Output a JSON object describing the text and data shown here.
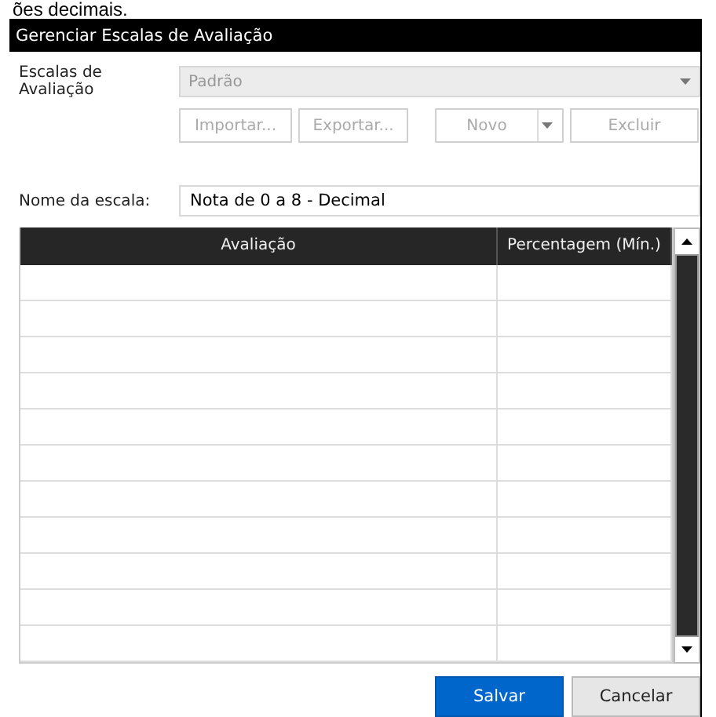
{
  "background_text": "ões decimais.",
  "window": {
    "title": "Gerenciar Escalas de Avaliação"
  },
  "scale_selector": {
    "label": "Escalas de Avaliação",
    "value": "Padrão",
    "disabled": true
  },
  "actions": [
    {
      "label": "Importar...",
      "kind": "plain",
      "disabled": true
    },
    {
      "label": "Exportar...",
      "kind": "plain",
      "disabled": true
    },
    {
      "label": "Novo",
      "kind": "split",
      "disabled": true
    },
    {
      "label": "Excluir",
      "kind": "plain",
      "disabled": true
    }
  ],
  "scale_name": {
    "label": "Nome da escala:",
    "value": "Nota de 0 a 8 - Decimal"
  },
  "table": {
    "columns": [
      "Avaliação",
      "Percentagem (Mín.)"
    ]
  },
  "buttons": [
    {
      "label": "Salvar",
      "kind": "primary"
    },
    {
      "label": "Cancelar",
      "kind": "secondary"
    }
  ]
}
